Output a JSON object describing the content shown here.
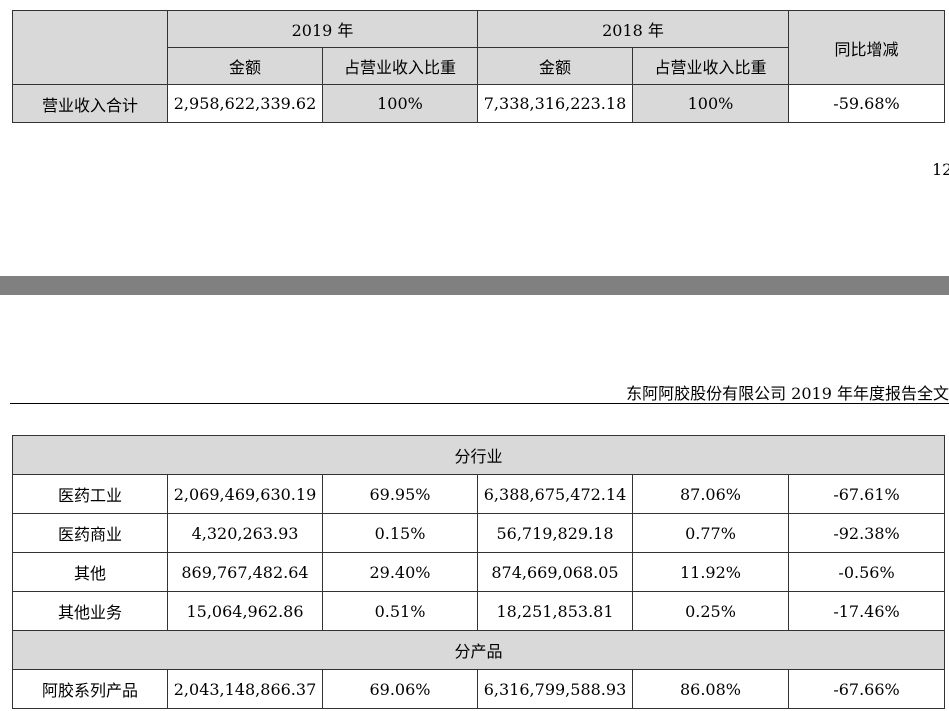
{
  "top_table": {
    "year_2019": "2019 年",
    "year_2018": "2018 年",
    "yoy_header": "同比增减",
    "amount_2019": "金额",
    "ratio_2019": "占营业收入比重",
    "amount_2018": "金额",
    "ratio_2018": "占营业收入比重",
    "total_row": {
      "label": "营业收入合计",
      "amount_2019": "2,958,622,339.62",
      "ratio_2019": "100%",
      "amount_2018": "7,338,316,223.18",
      "ratio_2018": "100%",
      "yoy": "-59.68%"
    }
  },
  "page_number": "12",
  "running_header": "东阿阿胶股份有限公司 2019 年年度报告全文",
  "bottom_table": {
    "section_industry": "分行业",
    "industry_rows": [
      {
        "label": "医药工业",
        "amount_2019": "2,069,469,630.19",
        "ratio_2019": "69.95%",
        "amount_2018": "6,388,675,472.14",
        "ratio_2018": "87.06%",
        "yoy": "-67.61%"
      },
      {
        "label": "医药商业",
        "amount_2019": "4,320,263.93",
        "ratio_2019": "0.15%",
        "amount_2018": "56,719,829.18",
        "ratio_2018": "0.77%",
        "yoy": "-92.38%"
      },
      {
        "label": "其他",
        "amount_2019": "869,767,482.64",
        "ratio_2019": "29.40%",
        "amount_2018": "874,669,068.05",
        "ratio_2018": "11.92%",
        "yoy": "-0.56%"
      },
      {
        "label": "其他业务",
        "amount_2019": "15,064,962.86",
        "ratio_2019": "0.51%",
        "amount_2018": "18,251,853.81",
        "ratio_2018": "0.25%",
        "yoy": "-17.46%"
      }
    ],
    "section_product": "分产品",
    "product_rows": [
      {
        "label": "阿胶系列产品",
        "amount_2019": "2,043,148,866.37",
        "ratio_2019": "69.06%",
        "amount_2018": "6,316,799,588.93",
        "ratio_2018": "86.08%",
        "yoy": "-67.66%"
      }
    ]
  }
}
